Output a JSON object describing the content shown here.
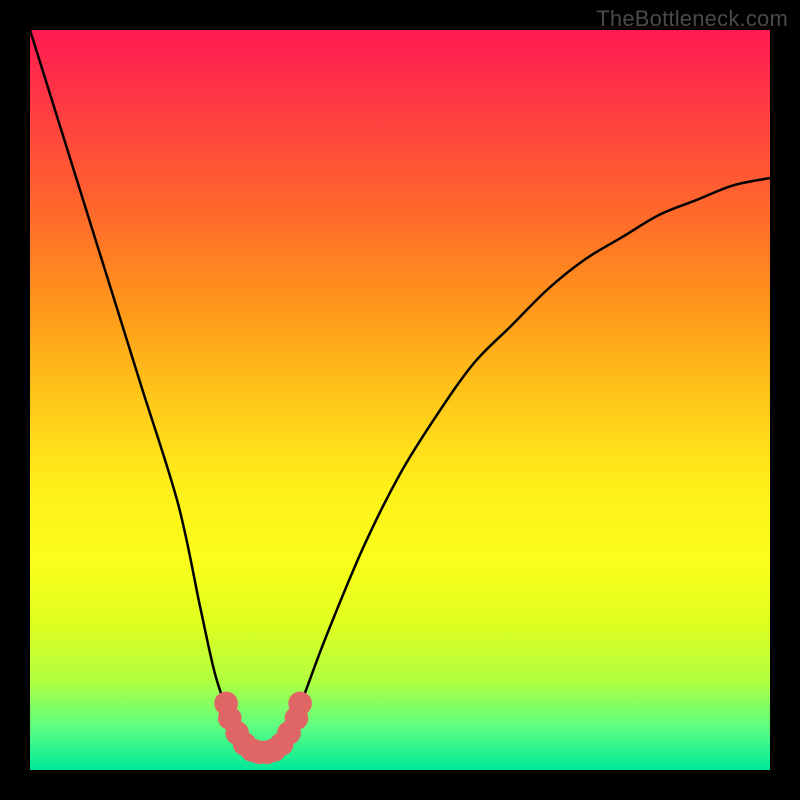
{
  "watermark": "TheBottleneck.com",
  "chart_data": {
    "type": "line",
    "title": "",
    "xlabel": "",
    "ylabel": "",
    "xlim": [
      0,
      100
    ],
    "ylim": [
      0,
      100
    ],
    "grid": false,
    "series": [
      {
        "name": "bottleneck-curve",
        "x": [
          0,
          5,
          10,
          15,
          20,
          23,
          25,
          27,
          28,
          29,
          30,
          31,
          32,
          33,
          34,
          35,
          37,
          40,
          45,
          50,
          55,
          60,
          65,
          70,
          75,
          80,
          85,
          90,
          95,
          100
        ],
        "y": [
          100,
          84,
          68,
          52,
          36,
          22,
          13,
          7,
          4,
          2.5,
          2,
          2,
          2,
          2.5,
          3.5,
          5,
          10,
          18,
          30,
          40,
          48,
          55,
          60,
          65,
          69,
          72,
          75,
          77,
          79,
          80
        ]
      }
    ],
    "markers": [
      {
        "x": 26.5,
        "y": 9,
        "r": 1.6
      },
      {
        "x": 27.0,
        "y": 7,
        "r": 1.6
      },
      {
        "x": 28.0,
        "y": 5,
        "r": 1.6
      },
      {
        "x": 29.0,
        "y": 3.5,
        "r": 1.6
      },
      {
        "x": 30.0,
        "y": 2.7,
        "r": 1.6
      },
      {
        "x": 31.0,
        "y": 2.4,
        "r": 1.6
      },
      {
        "x": 32.0,
        "y": 2.4,
        "r": 1.6
      },
      {
        "x": 33.0,
        "y": 2.7,
        "r": 1.6
      },
      {
        "x": 34.0,
        "y": 3.5,
        "r": 1.6
      },
      {
        "x": 35.0,
        "y": 5,
        "r": 1.6
      },
      {
        "x": 36.0,
        "y": 7,
        "r": 1.6
      },
      {
        "x": 36.5,
        "y": 9,
        "r": 1.6
      }
    ],
    "marker_color": "#e06666",
    "curve_color": "#000000"
  }
}
